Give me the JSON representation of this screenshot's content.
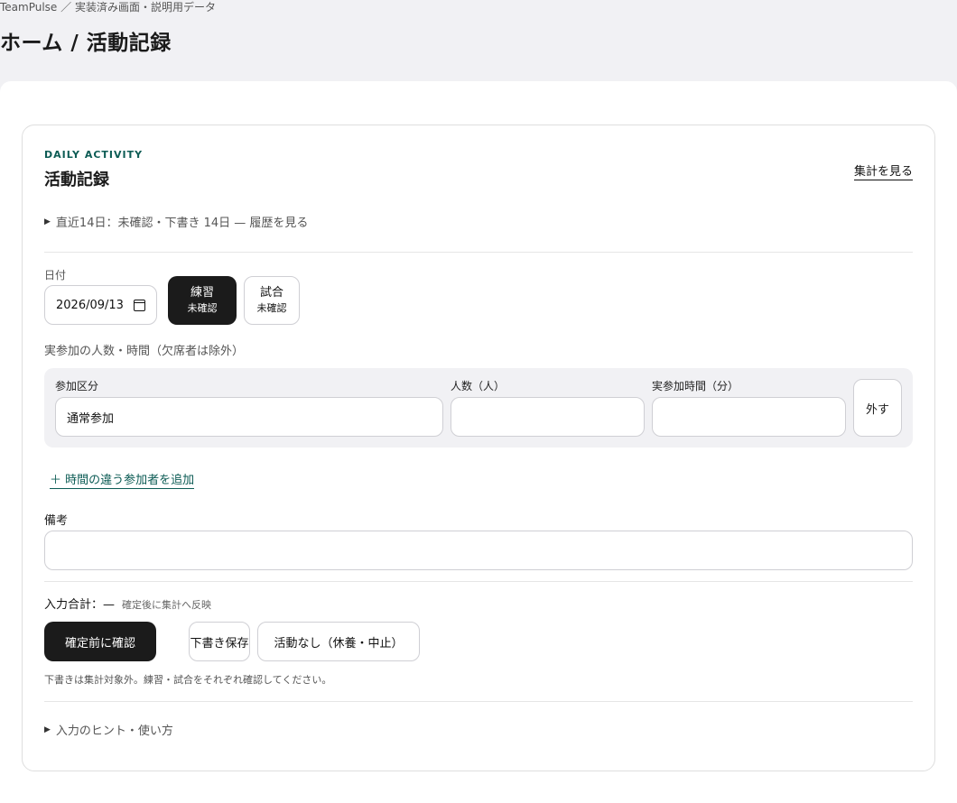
{
  "breadcrumb": "TeamPulse ／ 実装済み画面・説明用データ",
  "page_title": "ホーム / 活動記録",
  "card": {
    "eyebrow": "DAILY ACTIVITY",
    "title": "活動記録",
    "summary_link": "集計を見る",
    "history_toggle": "直近14日：未確認・下書き 14日 — 履歴を見る",
    "date_label": "日付",
    "date_value": "2026/09/13",
    "activity_types": [
      {
        "label": "練習",
        "status": "未確認",
        "selected": true
      },
      {
        "label": "試合",
        "status": "未確認",
        "selected": false
      }
    ],
    "participants_note": "実参加の人数・時間（欠席者は除外）",
    "participant_columns": {
      "category": "参加区分",
      "count": "人数（人）",
      "minutes": "実参加時間（分）"
    },
    "participant_row": {
      "category": "通常参加",
      "count": "",
      "minutes": ""
    },
    "remove_button": "外す",
    "add_link": "＋ 時間の違う参加者を追加",
    "notes_label": "備考",
    "notes_value": "",
    "total_label": "入力合計：—",
    "total_hint": "確定後に集計へ反映",
    "actions": {
      "confirm": "確定前に確認",
      "save_draft": "下書き保存",
      "no_activity": "活動なし（休養・中止）"
    },
    "footnote": "下書きは集計対象外。練習・試合をそれぞれ確認してください。",
    "hints_toggle": "入力のヒント・使い方"
  }
}
